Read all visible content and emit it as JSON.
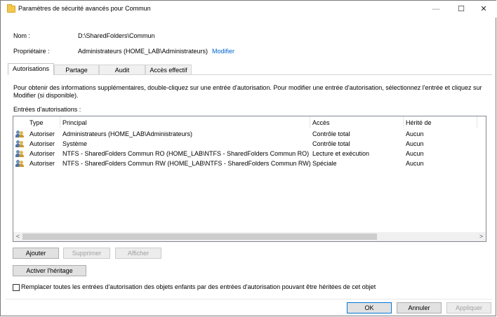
{
  "window": {
    "title": "Paramètres de sécurité avancés pour Commun",
    "minimize": "—",
    "maximize": "☐",
    "close": "✕"
  },
  "info": {
    "name_label": "Nom :",
    "name_value": "D:\\SharedFolders\\Commun",
    "owner_label": "Propriétaire :",
    "owner_value": "Administrateurs (HOME_LAB\\Administrateurs)",
    "owner_link": "Modifier"
  },
  "tabs": [
    {
      "label": "Autorisations",
      "active": true
    },
    {
      "label": "Partage",
      "active": false
    },
    {
      "label": "Audit",
      "active": false
    },
    {
      "label": "Accès effectif",
      "active": false
    }
  ],
  "instructions": {
    "line1": "Pour obtenir des informations supplémentaires, double-cliquez sur une entrée d'autorisation. Pour modifier une entrée d'autorisation, sélectionnez l'entrée et cliquez sur",
    "line2": "Modifier (si disponible)."
  },
  "entries_label": "Entrées d'autorisations :",
  "table": {
    "columns": [
      "Type",
      "Principal",
      "Accès",
      "Hérité de"
    ],
    "rows": [
      {
        "icon": "users-icon",
        "type": "Autoriser",
        "principal": "Administrateurs (HOME_LAB\\Administrateurs)",
        "access": "Contrôle total",
        "inherited": "Aucun"
      },
      {
        "icon": "users-icon",
        "type": "Autoriser",
        "principal": "Système",
        "access": "Contrôle total",
        "inherited": "Aucun"
      },
      {
        "icon": "users-icon",
        "type": "Autoriser",
        "principal": "NTFS - SharedFolders Commun RO (HOME_LAB\\NTFS - SharedFolders Commun RO)",
        "access": "Lecture et exécution",
        "inherited": "Aucun"
      },
      {
        "icon": "users-icon",
        "type": "Autoriser",
        "principal": "NTFS - SharedFolders Commun RW (HOME_LAB\\NTFS - SharedFolders Commun RW)",
        "access": "Spéciale",
        "inherited": "Aucun"
      }
    ],
    "scroll_left": "<",
    "scroll_right": ">"
  },
  "buttons": {
    "add": "Ajouter",
    "remove": "Supprimer",
    "view": "Afficher",
    "inherit": "Activer l'héritage",
    "ok": "OK",
    "cancel": "Annuler",
    "apply": "Appliquer"
  },
  "replace_checkbox": {
    "label": "Remplacer toutes les entrées d'autorisation des objets enfants par des entrées d'autorisation pouvant être héritées de cet objet",
    "checked": false
  }
}
